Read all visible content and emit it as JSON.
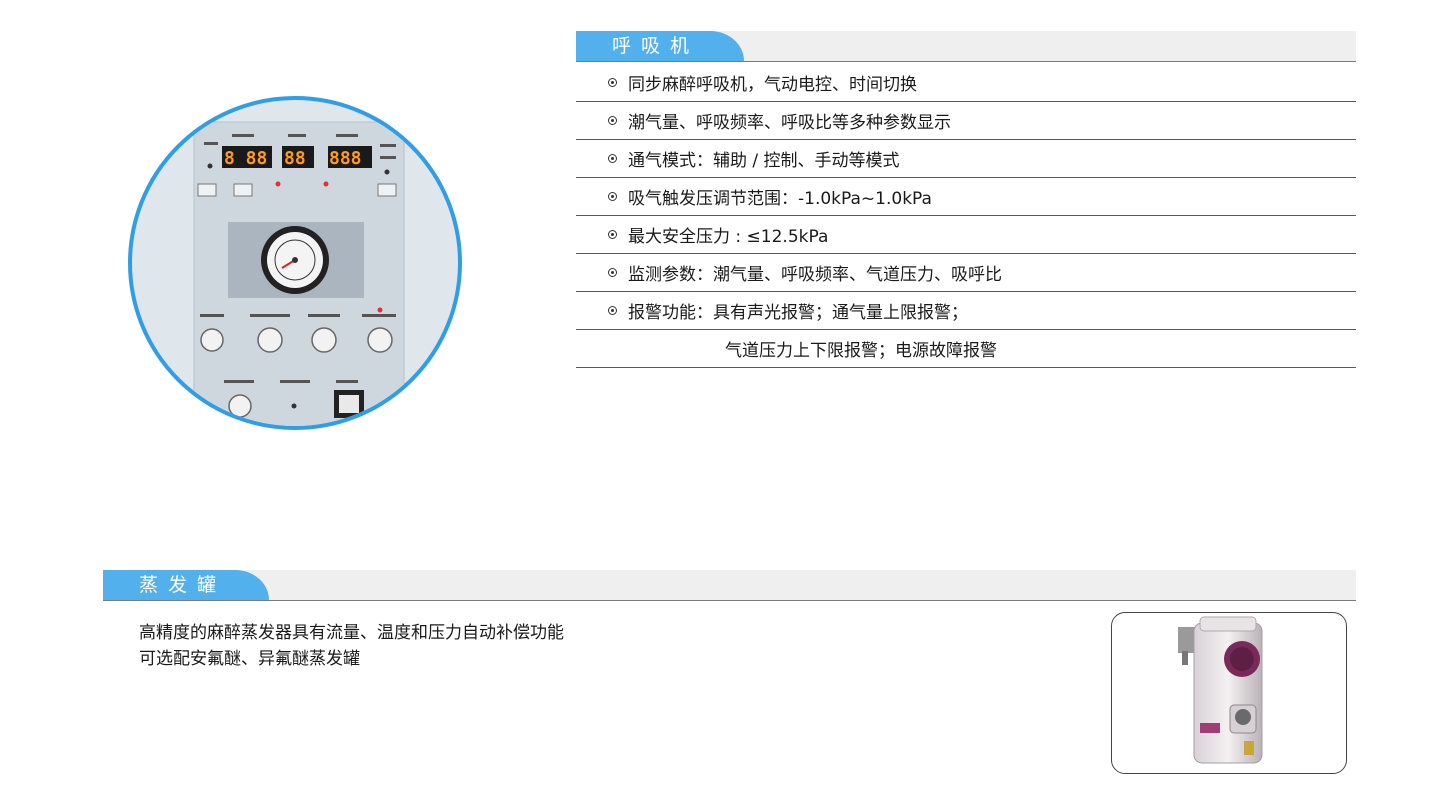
{
  "ventilator": {
    "title": "呼吸机",
    "features": [
      "同步麻醉呼吸机，气动电控、时间切换",
      "潮气量、呼吸频率、呼吸比等多种参数显示",
      "通气模式：辅助 / 控制、手动等模式",
      "吸气触发压调节范围：-1.0kPa~1.0kPa",
      "最大安全压力 : ≤12.5kPa",
      "监测参数：潮气量、呼吸频率、气道压力、吸呼比",
      "报警功能：具有声光报警；通气量上限报警；"
    ],
    "feature_continuation": "气道压力上下限报警；电源故障报警",
    "panel_image": {
      "accent_color": "#2f9ee6",
      "display_color": "#ff9a1a"
    }
  },
  "vaporizer": {
    "title": "蒸发罐",
    "lines": [
      "高精度的麻醉蒸发器具有流量、温度和压力自动补偿功能",
      "可选配安氟醚、异氟醚蒸发罐"
    ]
  },
  "colors": {
    "tab_blue": "#52b0ec",
    "bar_gray": "#efefef"
  }
}
